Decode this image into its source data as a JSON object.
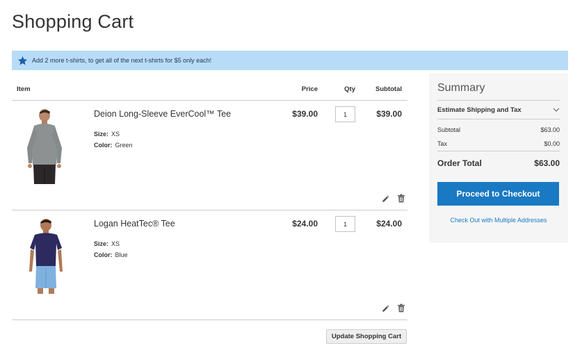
{
  "page": {
    "title": "Shopping Cart"
  },
  "promo": {
    "icon": "star-icon",
    "text": "Add 2 more t-shirts, to get all of the next t-shirts for $5 only each!",
    "color": "#b8dcf7"
  },
  "table": {
    "headers": {
      "item": "Item",
      "price": "Price",
      "qty": "Qty",
      "subtotal": "Subtotal"
    },
    "items": [
      {
        "name": "Deion Long-Sleeve EverCool™ Tee",
        "size_label": "Size:",
        "size": "XS",
        "color_label": "Color:",
        "color": "Green",
        "price": "$39.00",
        "qty": "1",
        "subtotal": "$39.00"
      },
      {
        "name": "Logan HeatTec® Tee",
        "size_label": "Size:",
        "size": "XS",
        "color_label": "Color:",
        "color": "Blue",
        "price": "$24.00",
        "qty": "1",
        "subtotal": "$24.00"
      }
    ],
    "update_button": "Update Shopping Cart"
  },
  "summary": {
    "title": "Summary",
    "estimate": "Estimate Shipping and Tax",
    "subtotal_label": "Subtotal",
    "subtotal": "$63.00",
    "tax_label": "Tax",
    "tax": "$0.00",
    "total_label": "Order Total",
    "total": "$63.00",
    "checkout_button": "Proceed to Checkout",
    "multi_address_link": "Check Out with Multiple Addresses"
  },
  "colors": {
    "accent": "#1979c3",
    "summary_bg": "#f5f5f5"
  }
}
